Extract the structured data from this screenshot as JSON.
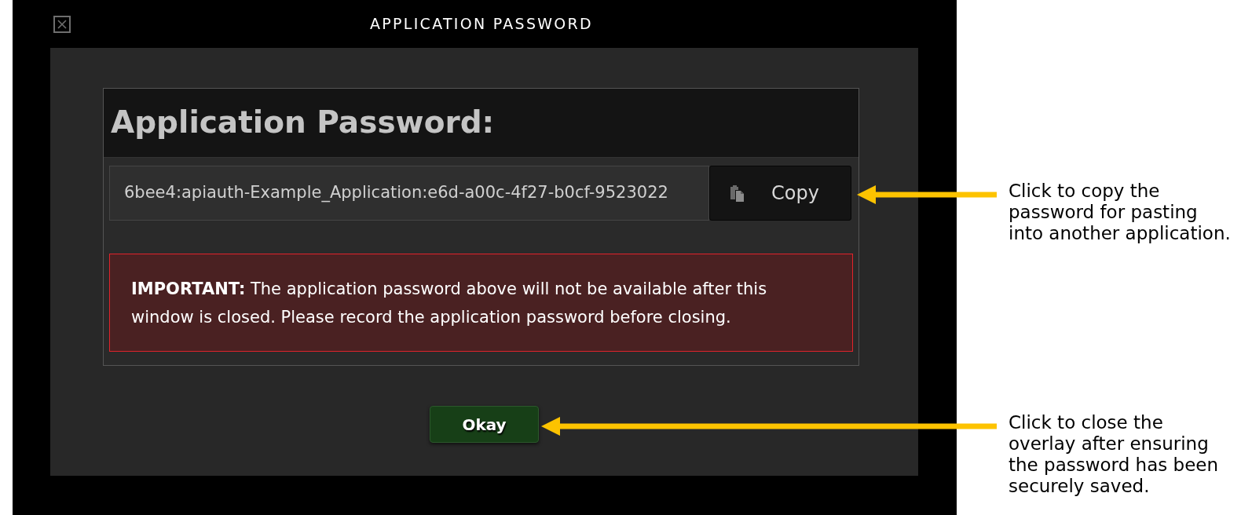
{
  "window": {
    "title": "APPLICATION PASSWORD"
  },
  "dialog": {
    "heading": "Application Password:",
    "password": {
      "value": "6bee4:apiauth-Example_Application:e6d-a00c-4f27-b0cf-9523022"
    },
    "copy_button": {
      "label": "Copy"
    },
    "warning": {
      "text": "**IMPORTANT:** The application password above will not be available after this window is closed. Please record the application password before closing."
    },
    "okay_button": {
      "label": "Okay"
    }
  },
  "annotations": [
    {
      "text": "Click to copy the\npassword for pasting\ninto another application."
    },
    {
      "text": "Click to close the\noverlay after ensuring\nthe password has been\nsecurely saved."
    }
  ]
}
